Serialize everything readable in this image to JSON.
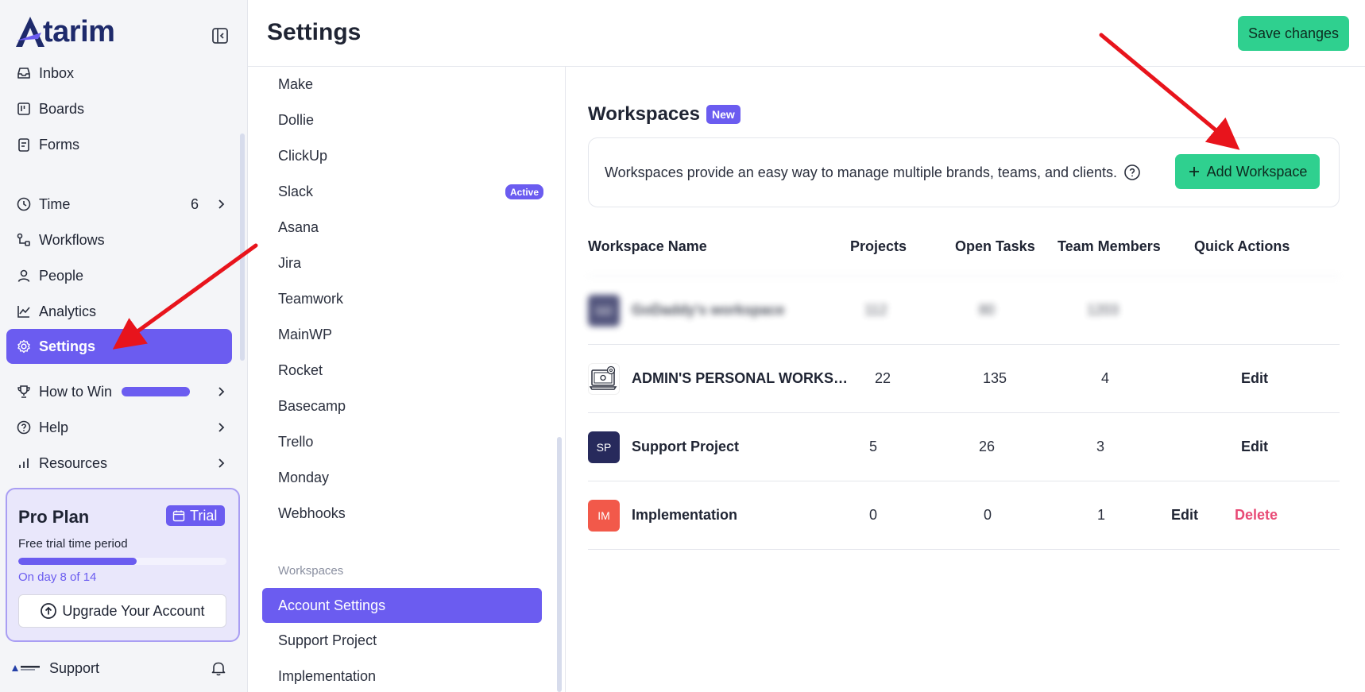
{
  "brand": {
    "name": "tarim",
    "color": "#1e2a6b"
  },
  "colors": {
    "accent": "#6b5cf0",
    "primary_action": "#2fd08f",
    "danger": "#e84a75"
  },
  "sidebar": {
    "items": [
      {
        "label": "Inbox",
        "icon": "inbox-icon"
      },
      {
        "label": "Boards",
        "icon": "board-icon"
      },
      {
        "label": "Forms",
        "icon": "form-icon"
      },
      {
        "label": "Time",
        "icon": "clock-icon",
        "count": "6"
      },
      {
        "label": "Workflows",
        "icon": "workflow-icon"
      },
      {
        "label": "People",
        "icon": "person-icon"
      },
      {
        "label": "Analytics",
        "icon": "chart-icon"
      },
      {
        "label": "Settings",
        "icon": "gear-icon",
        "active": true
      },
      {
        "label": "How to Win",
        "icon": "trophy-icon"
      },
      {
        "label": "Help",
        "icon": "help-icon"
      },
      {
        "label": "Resources",
        "icon": "bar-chart-icon"
      }
    ],
    "plan": {
      "title": "Pro Plan",
      "badge": "Trial",
      "subtitle": "Free trial time period",
      "progress": 0.57,
      "day_text": "On day 8 of 14",
      "upgrade_label": "Upgrade Your Account"
    },
    "support_label": "Support"
  },
  "header": {
    "title": "Settings",
    "save_label": "Save changes"
  },
  "submenu": {
    "items": [
      "Make",
      "Dollie",
      "ClickUp",
      "Slack",
      "Asana",
      "Jira",
      "Teamwork",
      "MainWP",
      "Rocket",
      "Basecamp",
      "Trello",
      "Monday",
      "Webhooks"
    ],
    "slack_badge": "Active",
    "section_label": "Workspaces",
    "workspace_items": [
      "Account Settings",
      "Support Project",
      "Implementation"
    ]
  },
  "main": {
    "title": "Workspaces",
    "new_badge": "New",
    "info_text": "Workspaces provide an easy way to manage multiple brands, teams, and clients.",
    "add_label": "Add Workspace",
    "columns": [
      "Workspace Name",
      "Projects",
      "Open Tasks",
      "Team Members",
      "Quick Actions"
    ],
    "rows": [
      {
        "avatar": "GD",
        "avatar_color": "#2a2d5e",
        "name": "GoDaddy's workspace",
        "projects": "112",
        "open_tasks": "80",
        "team_members": "1203",
        "blurred": true
      },
      {
        "avatar": "",
        "avatar_color": "#ffffff",
        "name": "ADMIN'S PERSONAL WORKSPAC...",
        "projects": "22",
        "open_tasks": "135",
        "team_members": "4",
        "edit": "Edit"
      },
      {
        "avatar": "SP",
        "avatar_color": "#272a5c",
        "name": "Support Project",
        "projects": "5",
        "open_tasks": "26",
        "team_members": "3",
        "edit": "Edit"
      },
      {
        "avatar": "IM",
        "avatar_color": "#f2594a",
        "name": "Implementation",
        "projects": "0",
        "open_tasks": "0",
        "team_members": "1",
        "edit": "Edit",
        "delete": "Delete"
      }
    ]
  }
}
